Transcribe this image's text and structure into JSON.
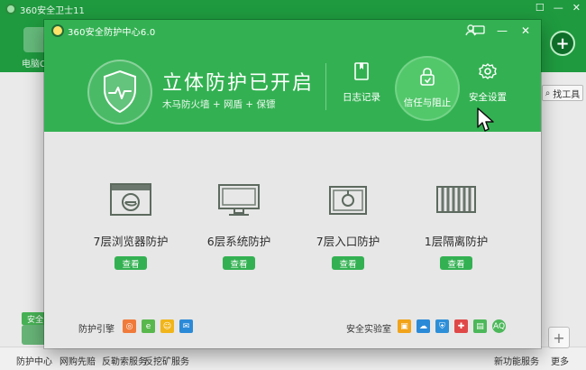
{
  "bg": {
    "title": "360安全卫士11",
    "tool_label": "电脑C",
    "find_tool": "找工具",
    "bottom": {
      "badge": "安全",
      "items": [
        "防护中心",
        "网购先赔",
        "反勒索服务",
        "反挖矿服务",
        "新功能服务",
        "更多"
      ]
    }
  },
  "modal": {
    "title": "360安全防护中心6.0",
    "headline": "立体防护已开启",
    "subline": "木马防火墙 + 网盾 + 保镖",
    "buttons": {
      "log": "日志记录",
      "trust": "信任与阻止",
      "settings": "安全设置"
    },
    "features": [
      {
        "label": "7层浏览器防护",
        "action": "查看"
      },
      {
        "label": "6层系统防护",
        "action": "查看"
      },
      {
        "label": "7层入口防护",
        "action": "查看"
      },
      {
        "label": "1层隔离防护",
        "action": "查看"
      }
    ],
    "footer": {
      "left_label": "防护引擎",
      "right_label": "安全实验室",
      "right_last_icon": "AQ"
    }
  },
  "colors": {
    "green": "#33b152",
    "green_dark": "#1f9a3f",
    "feature_icon": "#5d6a5f"
  }
}
